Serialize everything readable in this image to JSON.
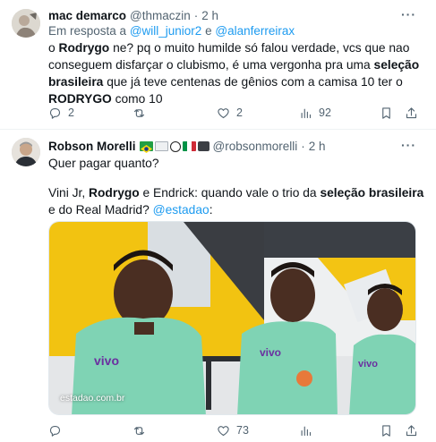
{
  "tweet1": {
    "display_name": "mac demarco",
    "handle": "@thmaczin",
    "time": "2 h",
    "reply_prefix": "Em resposta a",
    "reply_user1": "@will_junior2",
    "reply_and": "e",
    "reply_user2": "@alanferreirax",
    "text_1": "o ",
    "text_bold_1": "Rodrygo",
    "text_2": " ne? pq o muito humilde só falou verdade, vcs que nao conseguem disfarçar o clubismo, é uma vergonha pra uma ",
    "text_bold_2": "seleção brasileira",
    "text_3": " que já teve centenas de gênios com a camisa 10 ter o ",
    "text_bold_3": "RODRYGO",
    "text_4": " como 10",
    "replies": "2",
    "retweets": "",
    "likes": "2",
    "views": "92"
  },
  "tweet2": {
    "display_name": "Robson Morelli",
    "handle": "@robsonmorelli",
    "time": "2 h",
    "line1": "Quer pagar quanto?",
    "p2_1": "Vini Jr, ",
    "p2_bold_1": "Rodrygo",
    "p2_2": " e Endrick: quando vale o trio da ",
    "p2_bold_2": "seleção brasileira",
    "p2_3": " e do Real Madrid? ",
    "p2_link": "@estadao",
    "p2_4": ":",
    "image_watermark": "estadao.com.br",
    "replies": "",
    "retweets": "",
    "likes": "73",
    "views": ""
  },
  "icons": {
    "more": "more-icon",
    "reply": "reply-icon",
    "retweet": "retweet-icon",
    "like": "heart-icon",
    "views": "views-icon",
    "bookmark": "bookmark-icon",
    "share": "share-icon"
  },
  "colors": {
    "link": "#1d9bf0",
    "muted": "#536471",
    "jersey": "#7fd3b4",
    "sky": "#f3c413"
  }
}
